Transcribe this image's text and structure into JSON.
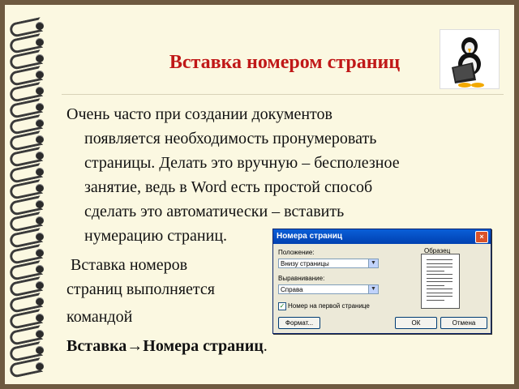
{
  "slide": {
    "title": "Вставка номером страниц",
    "paragraph_lines": [
      "Очень часто при создании документов",
      "появляется необходимость пронумеровать",
      "страницы. Делать это вручную – бесполезное",
      "занятие, ведь в Word есть простой способ",
      "сделать это автоматически – вставить",
      "нумерацию страниц."
    ],
    "line2": " Вставка номеров",
    "line3": "страниц выполняется",
    "line4": "командой",
    "command": "Вставка→Номера страниц",
    "command_tail": "."
  },
  "dialog": {
    "title": "Номера страниц",
    "close": "×",
    "position_label": "Положение:",
    "position_value": "Внизу страницы",
    "alignment_label": "Выравнивание:",
    "alignment_value": "Справа",
    "preview_label": "Образец",
    "first_page_label": "Номер на первой странице",
    "first_page_checked": true,
    "format_button": "Формат...",
    "ok_button": "ОК",
    "cancel_button": "Отмена"
  },
  "icons": {
    "mascot": "penguin-at-laptop-icon",
    "binding": "spiral-ring-icon"
  },
  "colors": {
    "title": "#c01818",
    "background": "#fbf8e1",
    "frame": "#6e5a40"
  }
}
